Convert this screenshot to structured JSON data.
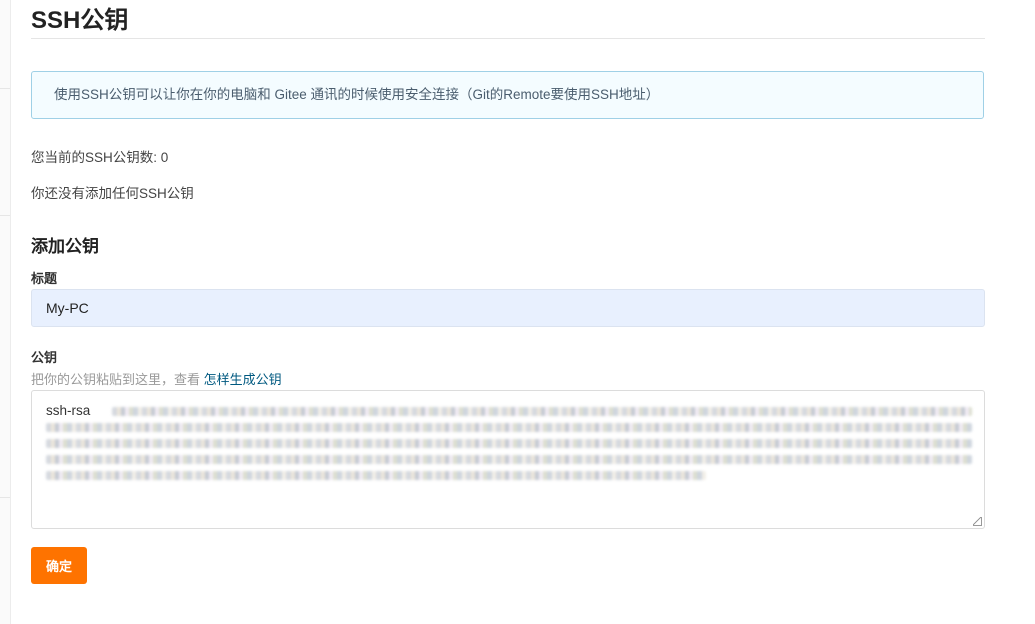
{
  "page": {
    "title": "SSH公钥"
  },
  "info": {
    "text": "使用SSH公钥可以让你在你的电脑和 Gitee 通讯的时候使用安全连接（Git的Remote要使用SSH地址）"
  },
  "status": {
    "count_text": "您当前的SSH公钥数: 0",
    "empty_text": "你还没有添加任何SSH公钥"
  },
  "add_key": {
    "section_title": "添加公钥",
    "title_label": "标题",
    "title_value": "My-PC",
    "key_label": "公钥",
    "hint_prefix": "把你的公钥粘贴到这里，查看 ",
    "hint_link": "怎样生成公钥",
    "key_prefix": "ssh-rsa",
    "submit_label": "确定"
  },
  "colors": {
    "accent": "#fe7300",
    "info_border": "#9fd0e6",
    "info_bg": "#f4fcff",
    "link": "#005980",
    "input_bg": "#e8f0fe"
  }
}
